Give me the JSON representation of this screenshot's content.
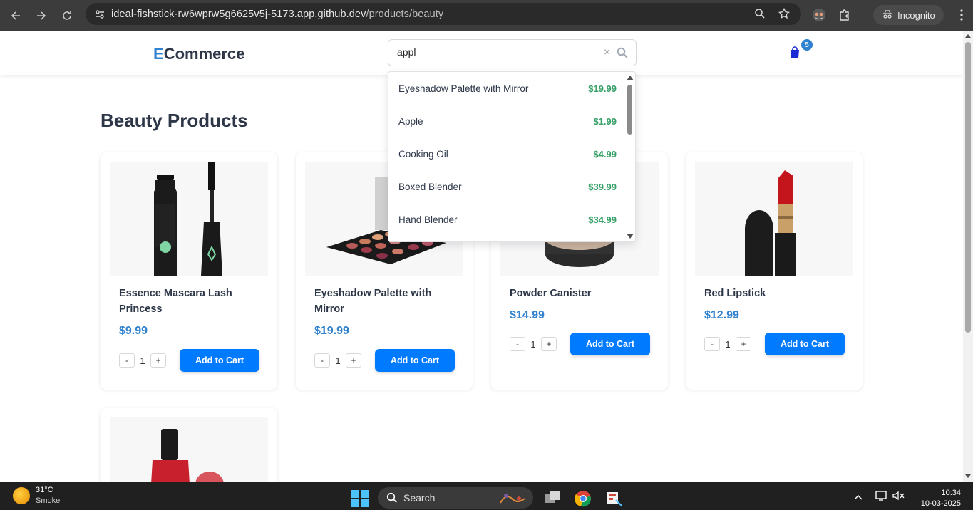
{
  "browser": {
    "url_host": "ideal-fishstick-rw6wprw5g6625v5j-5173.app.github.dev",
    "url_path": "/products/beauty",
    "profile_label": "Incognito"
  },
  "header": {
    "logo_first": "E",
    "logo_rest": "Commerce",
    "search_value": "appl",
    "clear_glyph": "×",
    "cart_count": "5"
  },
  "search_results": [
    {
      "name": "Eyeshadow Palette with Mirror",
      "price": "$19.99"
    },
    {
      "name": "Apple",
      "price": "$1.99"
    },
    {
      "name": "Cooking Oil",
      "price": "$4.99"
    },
    {
      "name": "Boxed Blender",
      "price": "$39.99"
    },
    {
      "name": "Hand Blender",
      "price": "$34.99"
    }
  ],
  "main": {
    "title": "Beauty Products",
    "add_label": "Add to Cart",
    "minus": "-",
    "plus": "+",
    "products": [
      {
        "name": "Essence Mascara Lash Princess",
        "price": "$9.99",
        "qty": "1",
        "image": "mascara"
      },
      {
        "name": "Eyeshadow Palette with Mirror",
        "price": "$19.99",
        "qty": "1",
        "image": "eyeshadow-palette"
      },
      {
        "name": "Powder Canister",
        "price": "$14.99",
        "qty": "1",
        "image": "powder-canister"
      },
      {
        "name": "Red Lipstick",
        "price": "$12.99",
        "qty": "1",
        "image": "red-lipstick"
      },
      {
        "name": "",
        "price": "",
        "qty": "",
        "image": "nail-polish"
      }
    ]
  },
  "taskbar": {
    "temp": "31°C",
    "weather": "Smoke",
    "search_label": "Search",
    "time": "10:34",
    "date": "10-03-2025"
  },
  "colors": {
    "accent": "#007bff",
    "brand": "#3182ce",
    "price_green": "#38a169",
    "heading": "#2d3748"
  }
}
